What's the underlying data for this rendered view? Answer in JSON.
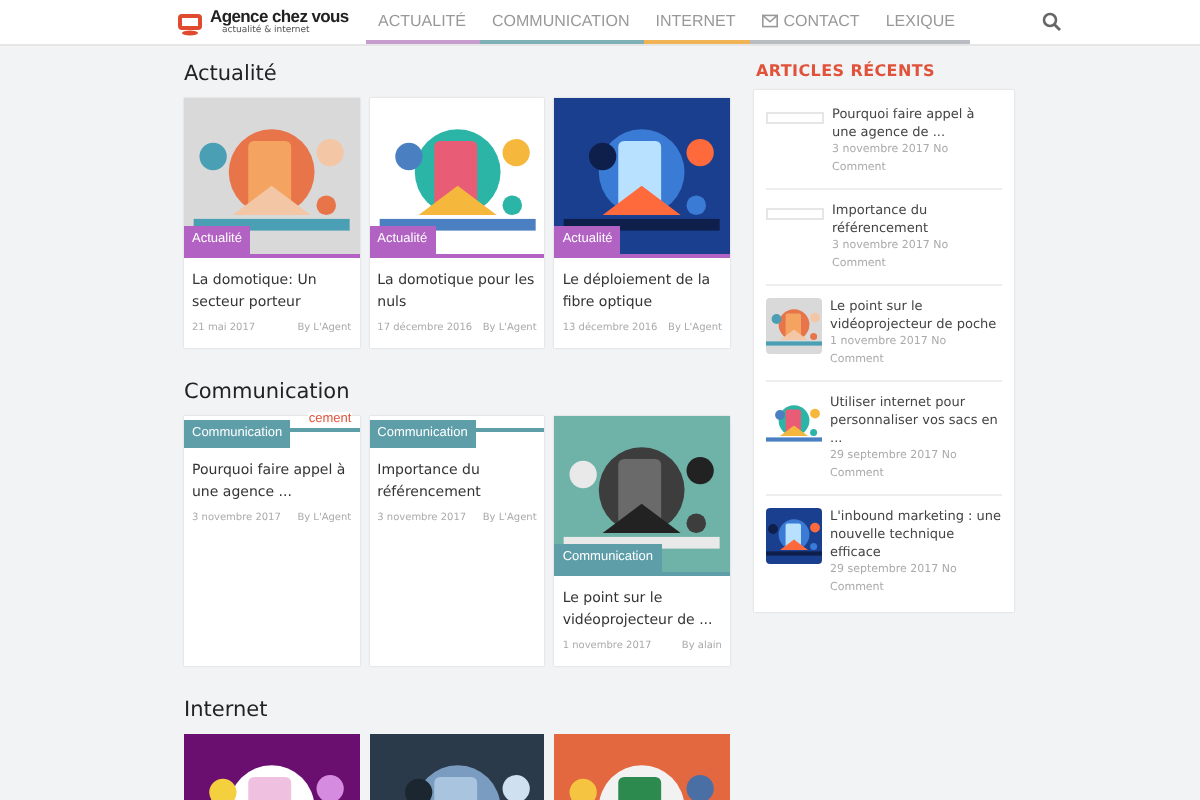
{
  "header": {
    "logo_title": "Agence chez vous",
    "logo_subtitle": "actualité & internet",
    "nav": [
      {
        "label": "ACTUALITÉ",
        "color": "#c79ccf",
        "kind": "plain"
      },
      {
        "label": "COMMUNICATION",
        "color": "#7fb0b6",
        "kind": "plain"
      },
      {
        "label": "INTERNET",
        "color": "#f0b455",
        "kind": "plain"
      },
      {
        "label": "CONTACT",
        "color": "#b9bcc0",
        "kind": "mail"
      },
      {
        "label": "LEXIQUE",
        "color": "#b9bcc0",
        "kind": "plain"
      }
    ]
  },
  "sections": [
    {
      "heading": "Actualité",
      "color": "#b162c2",
      "cards": [
        {
          "kind": "picture",
          "badge": "Actualité",
          "title": "La domotique: Un secteur porteur",
          "date": "21 mai 2017",
          "author": "By L'Agent"
        },
        {
          "kind": "picture",
          "badge": "Actualité",
          "title": "La domotique pour les nuls",
          "date": "17 décembre 2016",
          "author": "By L'Agent"
        },
        {
          "kind": "picture",
          "badge": "Actualité",
          "title": "Le déploiement de la fibre optique",
          "date": "13 décembre 2016",
          "author": "By L'Agent"
        }
      ]
    },
    {
      "heading": "Communication",
      "color": "#5e9ea9",
      "cards": [
        {
          "kind": "broken",
          "image_alt": "cement",
          "badge": "Communication",
          "title": "Pourquoi faire appel à une agence ...",
          "date": "3 novembre 2017",
          "author": "By L'Agent"
        },
        {
          "kind": "broken",
          "badge": "Communication",
          "title": "Importance du référencement",
          "date": "3 novembre 2017",
          "author": "By L'Agent"
        },
        {
          "kind": "picture",
          "badge": "Communication",
          "title": "Le point sur le vidéoprojecteur de ...",
          "date": "1 novembre 2017",
          "author": "By alain"
        }
      ]
    },
    {
      "heading": "Internet"
    }
  ],
  "sidebar": {
    "title": "ARTICLES RÉCENTS",
    "items": [
      {
        "kind": "broken",
        "title": "Pourquoi faire appel à une agence de ...",
        "meta": "3 novembre 2017 No Comment"
      },
      {
        "kind": "broken",
        "title": "Importance du référencement",
        "meta": "3 novembre 2017 No Comment"
      },
      {
        "kind": "picture",
        "title": "Le point sur le vidéoprojecteur de poche",
        "meta": "1 novembre 2017 No Comment"
      },
      {
        "kind": "picture",
        "title": "Utiliser internet pour personnaliser vos sacs en ...",
        "meta": "29 septembre 2017 No Comment"
      },
      {
        "kind": "picture",
        "title": "L'inbound marketing : une nouvelle technique efficace",
        "meta": "29 septembre 2017 No Comment"
      }
    ]
  }
}
